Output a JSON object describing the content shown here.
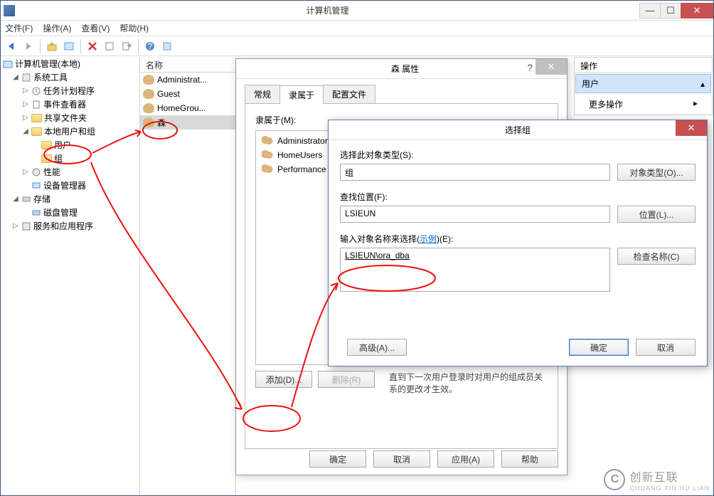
{
  "window": {
    "title": "计算机管理"
  },
  "menu": {
    "file": "文件(F)",
    "action": "操作(A)",
    "view": "查看(V)",
    "help": "帮助(H)"
  },
  "tree": {
    "root": "计算机管理(本地)",
    "systools": "系统工具",
    "task": "任务计划程序",
    "event": "事件查看器",
    "shared": "共享文件夹",
    "localusers": "本地用户和组",
    "users": "用户",
    "groups": "组",
    "perf": "性能",
    "device": "设备管理器",
    "storage": "存储",
    "disk": "磁盘管理",
    "services": "服务和应用程序"
  },
  "list": {
    "hdr": "名称",
    "items": [
      "Administrat...",
      "Guest",
      "HomeGrou...",
      "森"
    ]
  },
  "actions_pane": {
    "hdr": "操作",
    "section": "用户",
    "more": "更多操作"
  },
  "props": {
    "title": "森 属性",
    "tabs": {
      "general": "常规",
      "memberof": "隶属于",
      "profile": "配置文件"
    },
    "memberof_label": "隶属于(M):",
    "members": [
      "Administrators",
      "HomeUsers",
      "Performance Log"
    ],
    "add": "添加(D)...",
    "remove": "删除(R)",
    "note": "直到下一次用户登录时对用户的组成员关系的更改才生效。",
    "ok": "确定",
    "cancel": "取消",
    "apply": "应用(A)",
    "help": "帮助"
  },
  "select": {
    "title": "选择组",
    "obj_label": "选择此对象类型(S):",
    "obj_value": "组",
    "obj_btn": "对象类型(O)...",
    "loc_label": "查找位置(F):",
    "loc_value": "LSIEUN",
    "loc_btn": "位置(L)...",
    "name_label_1": "输入对象名称来选择(",
    "name_label_link": "示例",
    "name_label_2": ")(E):",
    "name_value": "LSIEUN\\ora_dba",
    "check_btn": "检查名称(C)",
    "advanced": "高级(A)...",
    "ok": "确定",
    "cancel": "取消"
  },
  "watermark": {
    "brand": "创新互联",
    "sub": "CHUANG XIN HU LIAN"
  }
}
